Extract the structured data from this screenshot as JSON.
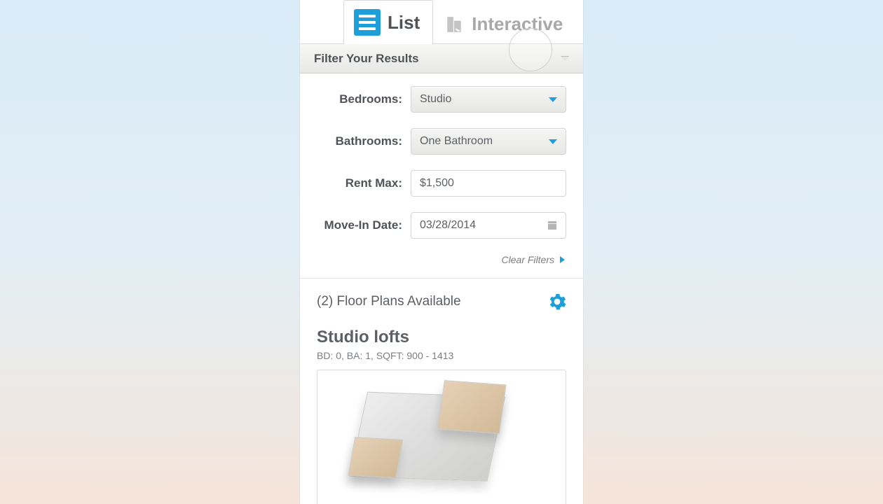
{
  "tabs": {
    "list": "List",
    "interactive": "Interactive"
  },
  "filter": {
    "header": "Filter Your Results",
    "labels": {
      "bedrooms": "Bedrooms:",
      "bathrooms": "Bathrooms:",
      "rent_max": "Rent Max:",
      "movein": "Move-In Date:"
    },
    "values": {
      "bedrooms": "Studio",
      "bathrooms": "One Bathroom",
      "rent_max": "$1,500",
      "movein": "03/28/2014"
    },
    "clear": "Clear Filters"
  },
  "results": {
    "count_label": "(2) Floor Plans Available",
    "plan": {
      "title": "Studio lofts",
      "meta": "BD: 0,  BA: 1,  SQFT: 900 - 1413"
    }
  }
}
